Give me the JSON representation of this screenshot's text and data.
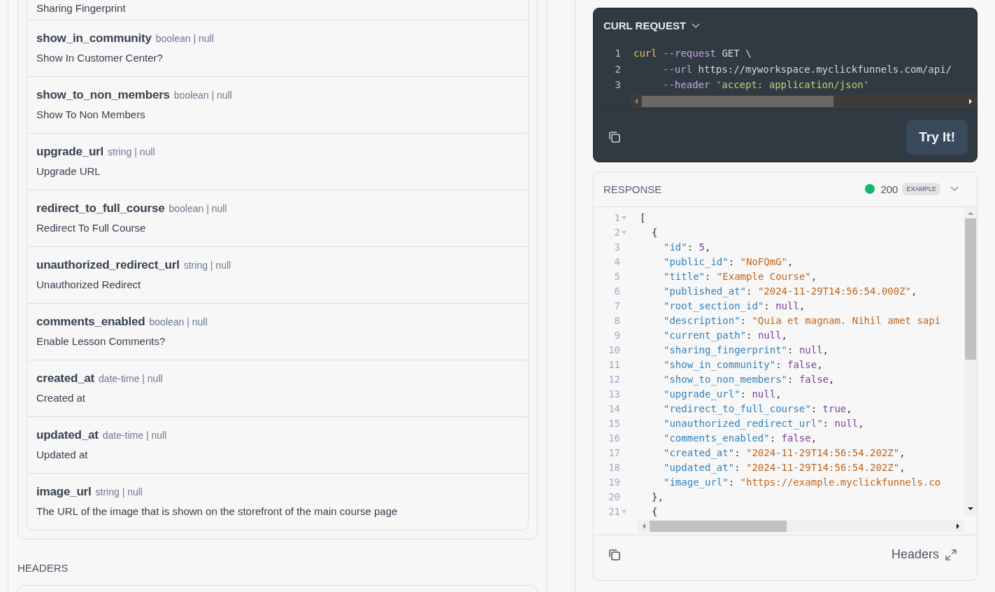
{
  "fields_top_description": "Sharing Fingerprint",
  "fields": [
    {
      "name": "show_in_community",
      "type": "boolean | null",
      "description": "Show In Customer Center?"
    },
    {
      "name": "show_to_non_members",
      "type": "boolean | null",
      "description": "Show To Non Members"
    },
    {
      "name": "upgrade_url",
      "type": "string | null",
      "description": "Upgrade URL"
    },
    {
      "name": "redirect_to_full_course",
      "type": "boolean | null",
      "description": "Redirect To Full Course"
    },
    {
      "name": "unauthorized_redirect_url",
      "type": "string | null",
      "description": "Unauthorized Redirect"
    },
    {
      "name": "comments_enabled",
      "type": "boolean | null",
      "description": "Enable Lesson Comments?"
    },
    {
      "name": "created_at",
      "type": "date-time | null",
      "description": "Created at"
    },
    {
      "name": "updated_at",
      "type": "date-time | null",
      "description": "Updated at"
    },
    {
      "name": "image_url",
      "type": "string | null",
      "description": "The URL of the image that is shown on the storefront of the main course page"
    }
  ],
  "headers_title": "HEADERS",
  "curl": {
    "title": "CURL REQUEST",
    "button": "Try It!",
    "lines": [
      {
        "n": "1",
        "kind": "command",
        "cmd": "curl",
        "flag": "--request",
        "arg": {
          "kind": "plain",
          "text": "GET \\"
        }
      },
      {
        "n": "2",
        "kind": "option",
        "flag": "--url",
        "arg": {
          "kind": "plain",
          "text": "https://myworkspace.myclickfunnels.com/api/"
        }
      },
      {
        "n": "3",
        "kind": "option",
        "flag": "--header",
        "arg": {
          "kind": "string",
          "text": "'accept: application/json'"
        }
      }
    ]
  },
  "response": {
    "title": "RESPONSE",
    "status": {
      "code": "200",
      "color": "#12b76a"
    },
    "badge": "EXAMPLE",
    "footer_link": "Headers",
    "lines": [
      {
        "n": "1",
        "fold": true,
        "kind": "outer",
        "text": "["
      },
      {
        "n": "2",
        "fold": true,
        "kind": "bracket",
        "text": "{"
      },
      {
        "n": "3",
        "fold": false,
        "kind": "entry",
        "key": "\"id\"",
        "sep": ":",
        "value": {
          "kind": "literal",
          "text": "5"
        },
        "tail": ","
      },
      {
        "n": "4",
        "fold": false,
        "kind": "entry",
        "key": "\"public_id\"",
        "sep": ":",
        "value": {
          "kind": "string",
          "text": "\"NoFQmG\""
        },
        "tail": ","
      },
      {
        "n": "5",
        "fold": false,
        "kind": "entry",
        "key": "\"title\"",
        "sep": ":",
        "value": {
          "kind": "string",
          "text": "\"Example Course\""
        },
        "tail": ","
      },
      {
        "n": "6",
        "fold": false,
        "kind": "entry",
        "key": "\"published_at\"",
        "sep": ":",
        "value": {
          "kind": "string",
          "text": "\"2024-11-29T14:56:54.000Z\""
        },
        "tail": ","
      },
      {
        "n": "7",
        "fold": false,
        "kind": "entry",
        "key": "\"root_section_id\"",
        "sep": ":",
        "value": {
          "kind": "literal",
          "text": "null"
        },
        "tail": ","
      },
      {
        "n": "8",
        "fold": false,
        "kind": "entry",
        "key": "\"description\"",
        "sep": ":",
        "value": {
          "kind": "string",
          "text": "\"Quia et magnam. Nihil amet sapi"
        }
      },
      {
        "n": "9",
        "fold": false,
        "kind": "entry",
        "key": "\"current_path\"",
        "sep": ":",
        "value": {
          "kind": "literal",
          "text": "null"
        },
        "tail": ","
      },
      {
        "n": "10",
        "fold": false,
        "kind": "entry",
        "key": "\"sharing_fingerprint\"",
        "sep": ":",
        "value": {
          "kind": "literal",
          "text": "null"
        },
        "tail": ","
      },
      {
        "n": "11",
        "fold": false,
        "kind": "entry",
        "key": "\"show_in_community\"",
        "sep": ":",
        "value": {
          "kind": "literal",
          "text": "false"
        },
        "tail": ","
      },
      {
        "n": "12",
        "fold": false,
        "kind": "entry",
        "key": "\"show_to_non_members\"",
        "sep": ":",
        "value": {
          "kind": "literal",
          "text": "false"
        },
        "tail": ","
      },
      {
        "n": "13",
        "fold": false,
        "kind": "entry",
        "key": "\"upgrade_url\"",
        "sep": ":",
        "value": {
          "kind": "literal",
          "text": "null"
        },
        "tail": ","
      },
      {
        "n": "14",
        "fold": false,
        "kind": "entry",
        "key": "\"redirect_to_full_course\"",
        "sep": ":",
        "value": {
          "kind": "literal",
          "text": "true"
        },
        "tail": ","
      },
      {
        "n": "15",
        "fold": false,
        "kind": "entry",
        "key": "\"unauthorized_redirect_url\"",
        "sep": ":",
        "value": {
          "kind": "literal",
          "text": "null"
        },
        "tail": ","
      },
      {
        "n": "16",
        "fold": false,
        "kind": "entry",
        "key": "\"comments_enabled\"",
        "sep": ":",
        "value": {
          "kind": "literal",
          "text": "false"
        },
        "tail": ","
      },
      {
        "n": "17",
        "fold": false,
        "kind": "entry",
        "key": "\"created_at\"",
        "sep": ":",
        "value": {
          "kind": "string",
          "text": "\"2024-11-29T14:56:54.202Z\""
        },
        "tail": ","
      },
      {
        "n": "18",
        "fold": false,
        "kind": "entry",
        "key": "\"updated_at\"",
        "sep": ":",
        "value": {
          "kind": "string",
          "text": "\"2024-11-29T14:56:54.202Z\""
        },
        "tail": ","
      },
      {
        "n": "19",
        "fold": false,
        "kind": "entry",
        "key": "\"image_url\"",
        "sep": ":",
        "value": {
          "kind": "string",
          "text": "\"https://example.myclickfunnels.co"
        }
      },
      {
        "n": "20",
        "fold": false,
        "kind": "bracket",
        "text": "},"
      },
      {
        "n": "21",
        "fold": true,
        "kind": "bracket",
        "text": "{"
      }
    ]
  }
}
